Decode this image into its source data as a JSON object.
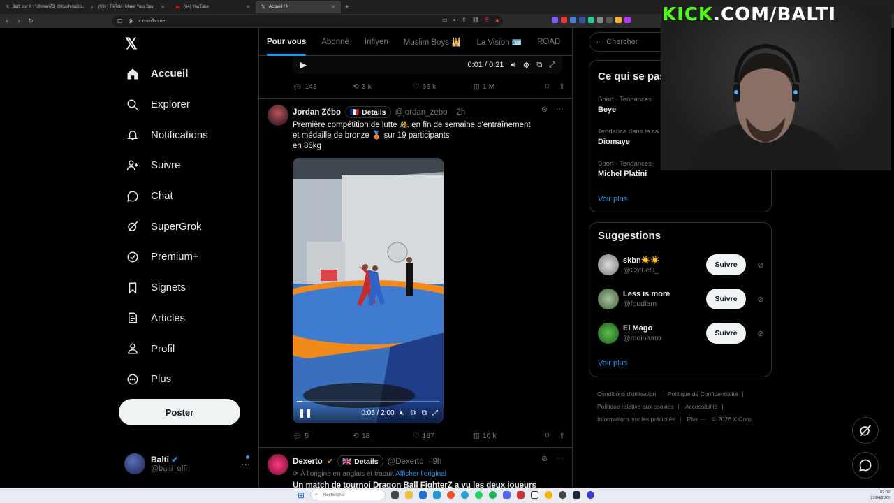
{
  "browser": {
    "tabs": [
      {
        "title": "Balti sur X : \"@iman75I @KushinaGo...",
        "active": false
      },
      {
        "title": "(99+) TikTok - Make Your Day",
        "active": false
      },
      {
        "title": "(64) YouTube",
        "active": false
      },
      {
        "title": "Accueil / X",
        "active": true
      }
    ],
    "url": "x.com/home"
  },
  "overlay": {
    "kick_green": "KICK",
    "kick_rest": ".COM/BALTI"
  },
  "nav": {
    "items": [
      {
        "label": "Accueil",
        "icon": "home-icon"
      },
      {
        "label": "Explorer",
        "icon": "search-icon"
      },
      {
        "label": "Notifications",
        "icon": "bell-icon"
      },
      {
        "label": "Suivre",
        "icon": "add-person-icon"
      },
      {
        "label": "Chat",
        "icon": "chat-icon"
      },
      {
        "label": "SuperGrok",
        "icon": "grok-icon"
      },
      {
        "label": "Premium+",
        "icon": "verified-icon"
      },
      {
        "label": "Signets",
        "icon": "bookmark-icon"
      },
      {
        "label": "Articles",
        "icon": "article-icon"
      },
      {
        "label": "Profil",
        "icon": "person-icon"
      },
      {
        "label": "Plus",
        "icon": "more-circle-icon"
      }
    ],
    "post_button": "Poster",
    "account": {
      "name": "Balti",
      "handle": "@balti_offi"
    }
  },
  "feed": {
    "tabs": [
      "Pour vous",
      "Abonné",
      "Irifiyen",
      "Muslim Boys 🕌",
      "La Vision 🪪",
      "ROAD"
    ],
    "prev_post": {
      "time": "0:01 / 0:21",
      "replies": "143",
      "reposts": "3 k",
      "likes": "66 k",
      "views": "1 M"
    },
    "post1": {
      "name": "Jordan Zébo",
      "flag": "🇫🇷",
      "details": "Details",
      "handle": "@jordan_zebo",
      "age": "· 2h",
      "text_line1": "Première compétition de lutte 🤼 en fin de semaine d'entraînement",
      "text_line2": "et médaille de bronze 🥉 sur 19 participants",
      "text_line3": "en 86kg",
      "video_time": "0:05 / 2:00",
      "video_progress": 0.04,
      "replies": "5",
      "reposts": "18",
      "likes": "167",
      "views": "10 k"
    },
    "post2": {
      "name": "Dexerto",
      "flag": "🇬🇧",
      "details": "Details",
      "handle": "@Dexerto",
      "age": "· 9h",
      "translated": "À l'origine en anglais et traduit",
      "show_original": "Afficher l'original",
      "text_partial": "Un match de tournoi Dragon Ball FighterZ a vu les deux joueurs exécuter"
    }
  },
  "right": {
    "search_placeholder": "Chercher",
    "trends_title": "Ce qui se pas",
    "trends": [
      {
        "category": "Sport · Tendances",
        "title": "Beye"
      },
      {
        "category": "Tendance dans la ca",
        "title": "Diomaye"
      },
      {
        "category": "Sport · Tendances",
        "title": "Michel Platini"
      }
    ],
    "see_more": "Voir plus",
    "suggestions_title": "Suggestions",
    "suggestions": [
      {
        "name": "skbn☀️☀️",
        "handle": "@CstLeS_",
        "button": "Suivre"
      },
      {
        "name": "Less is more",
        "handle": "@foudlam",
        "button": "Suivre"
      },
      {
        "name": "El Mago",
        "handle": "@moinaaro",
        "button": "Suivre"
      }
    ],
    "footer": [
      "Conditions d'utilisation",
      "Politique de Confidentialité",
      "Politique relative aux cookies",
      "Accessibilité",
      "Informations sur les publicités",
      "Plus ···",
      "© 2026 X Corp."
    ]
  },
  "taskbar": {
    "search": "Rechercher",
    "time": "02:09",
    "date": "21/04/2026"
  },
  "colors": {
    "accent": "#1d9bf0",
    "kick": "#53fc18",
    "background": "#000000"
  }
}
